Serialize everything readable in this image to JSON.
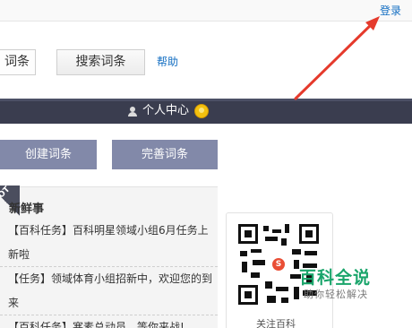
{
  "topbar": {
    "login_label": "登录"
  },
  "search": {
    "input_value": "词条",
    "search_button": "搜索词条",
    "help_link": "帮助"
  },
  "nav": {
    "user_center": "个人中心"
  },
  "actions": {
    "create": "创建词条",
    "improve": "完善词条"
  },
  "news": {
    "hot_label": "OT",
    "title": "新鲜事",
    "items": [
      "【百科任务】百科明星领域小组6月任务上新啦",
      "【任务】领域体育小组招新中，欢迎您的到来",
      "【百科任务】寒素总动员，等你来战!"
    ]
  },
  "qr": {
    "logo_letter": "S",
    "follow_text": "关注百科"
  },
  "watermark": {
    "title": "百科全说",
    "subtitle": "助你轻松解决"
  },
  "colors": {
    "accent_blue": "#136ec2",
    "nav_bg": "#3a3d4f",
    "button_bg": "#8289a9",
    "arrow_red": "#e53a2c",
    "brand_green": "#1aa56b"
  }
}
